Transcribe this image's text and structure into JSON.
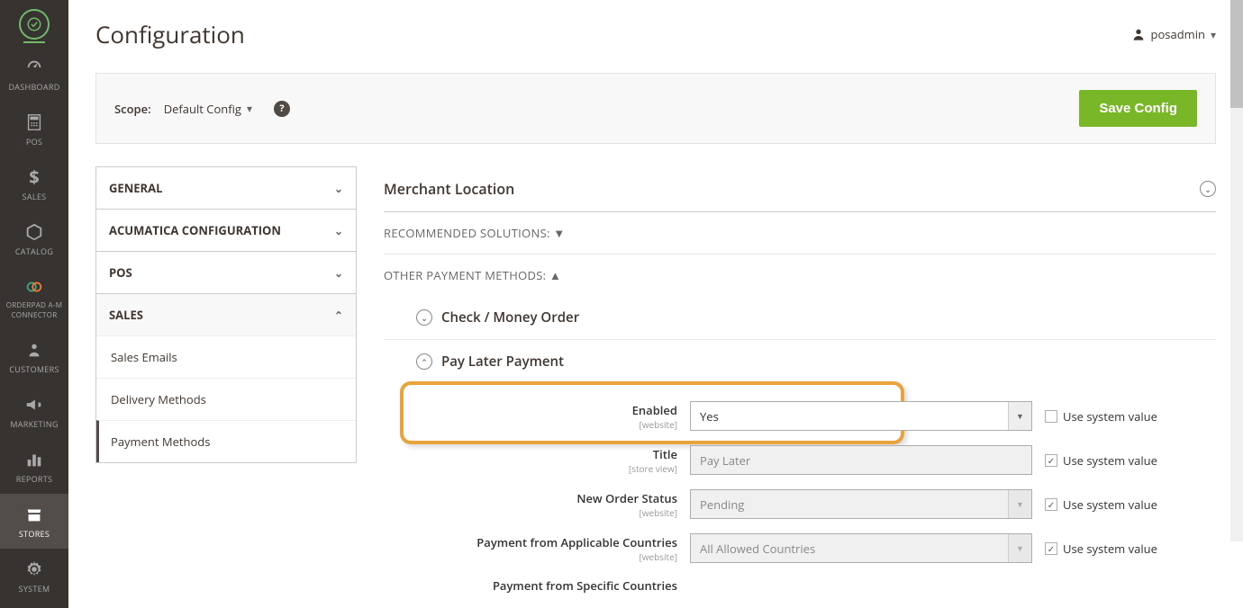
{
  "user": "posadmin",
  "page_title": "Configuration",
  "scope": {
    "label": "Scope:",
    "value": "Default Config"
  },
  "save_button": "Save Config",
  "sidebar": {
    "items": [
      {
        "label": "DASHBOARD"
      },
      {
        "label": "POS"
      },
      {
        "label": "SALES"
      },
      {
        "label": "CATALOG"
      },
      {
        "label": "ORDERPAD A-M CONNECTOR"
      },
      {
        "label": "CUSTOMERS"
      },
      {
        "label": "MARKETING"
      },
      {
        "label": "REPORTS"
      },
      {
        "label": "STORES"
      },
      {
        "label": "SYSTEM"
      }
    ]
  },
  "accordion": {
    "general": "GENERAL",
    "acumatica": "ACUMATICA CONFIGURATION",
    "pos": "POS",
    "sales": "SALES",
    "sales_items": {
      "emails": "Sales Emails",
      "delivery": "Delivery Methods",
      "payment": "Payment Methods"
    }
  },
  "sections": {
    "merchant": "Merchant Location",
    "recommended": "RECOMMENDED SOLUTIONS: ▼",
    "other": "OTHER PAYMENT METHODS: ▲",
    "check": "Check / Money Order",
    "paylater": "Pay Later Payment"
  },
  "form": {
    "enabled": {
      "label": "Enabled",
      "hint": "[website]",
      "value": "Yes",
      "use_system": "Use system value"
    },
    "title": {
      "label": "Title",
      "hint": "[store view]",
      "value": "Pay Later",
      "use_system": "Use system value"
    },
    "status": {
      "label": "New Order Status",
      "hint": "[website]",
      "value": "Pending",
      "use_system": "Use system value"
    },
    "countries": {
      "label": "Payment from Applicable Countries",
      "hint": "[website]",
      "value": "All Allowed Countries",
      "use_system": "Use system value"
    },
    "specific": {
      "label": "Payment from Specific Countries"
    }
  }
}
